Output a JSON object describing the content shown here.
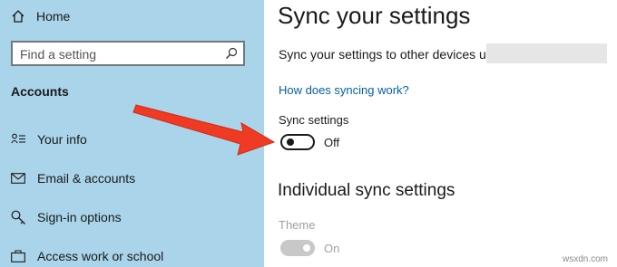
{
  "sidebar": {
    "home_label": "Home",
    "search_placeholder": "Find a setting",
    "section_title": "Accounts",
    "items": [
      {
        "label": "Your info"
      },
      {
        "label": "Email & accounts"
      },
      {
        "label": "Sign-in options"
      },
      {
        "label": "Access work or school"
      }
    ]
  },
  "main": {
    "title": "Sync your settings",
    "description": "Sync your settings to other devices using",
    "link": "How does syncing work?",
    "sync_label": "Sync settings",
    "sync_state": "Off",
    "individual_title": "Individual sync settings",
    "theme_label": "Theme",
    "theme_state": "On"
  },
  "watermark": "wsxdn.com",
  "colors": {
    "sidebar_bg": "#a9d4ea",
    "link": "#0063b1",
    "arrow": "#ef3b24"
  }
}
